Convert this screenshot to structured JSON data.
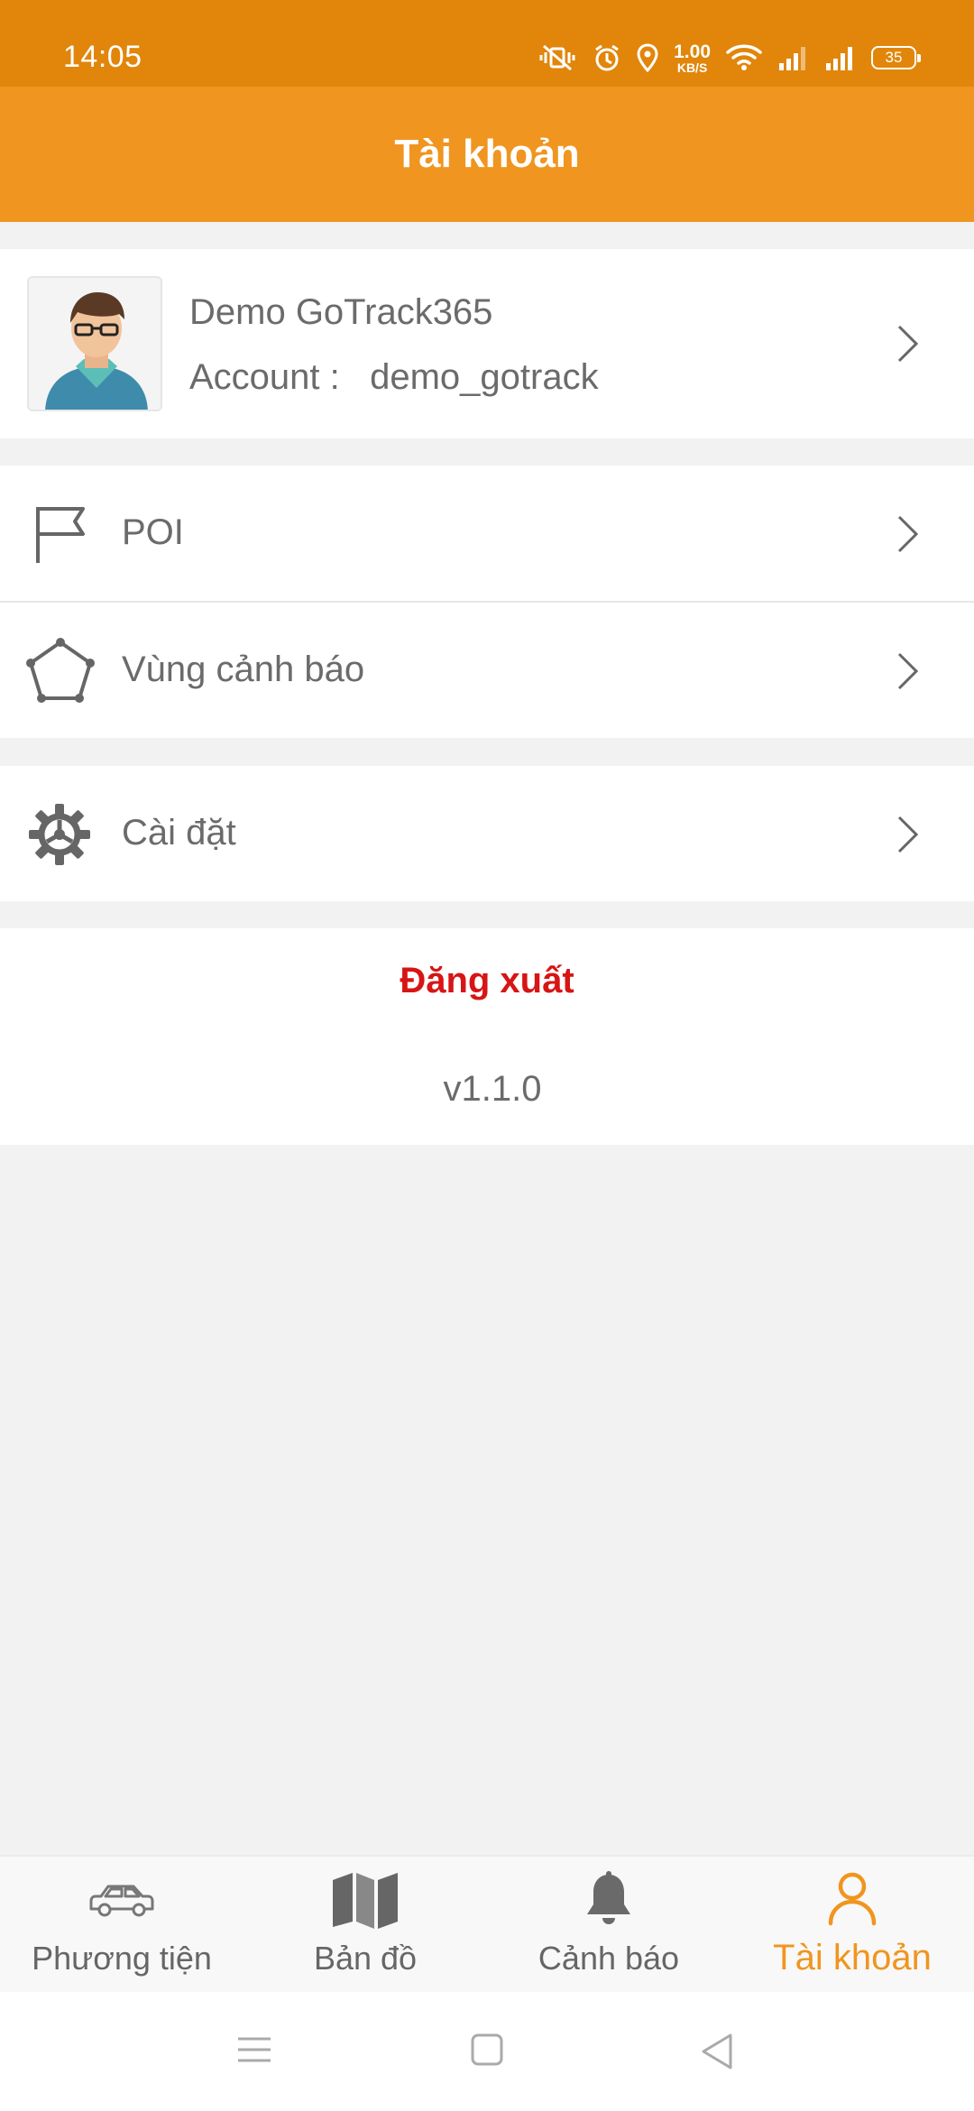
{
  "status_bar": {
    "time": "14:05",
    "net_speed_value": "1.00",
    "net_speed_unit": "KB/S",
    "battery": "35",
    "icons": [
      "vibrate-icon",
      "alarm-icon",
      "location-icon",
      "wifi-icon",
      "signal-icon",
      "signal-icon",
      "battery-icon"
    ]
  },
  "app_bar": {
    "title": "Tài khoản"
  },
  "profile": {
    "name": "Demo GoTrack365",
    "account_label": "Account :",
    "account_value": "demo_gotrack",
    "avatar_icon": "user-avatar"
  },
  "menu": {
    "poi_label": "POI",
    "zones_label": "Vùng cảnh báo",
    "settings_label": "Cài đặt"
  },
  "logout": {
    "label": "Đăng xuất"
  },
  "version": "v1.1.0",
  "bottom_nav": {
    "items": [
      {
        "label": "Phương tiện",
        "icon": "car-icon"
      },
      {
        "label": "Bản đồ",
        "icon": "map-icon"
      },
      {
        "label": "Cảnh báo",
        "icon": "bell-icon"
      },
      {
        "label": "Tài khoản",
        "icon": "user-icon"
      }
    ],
    "active_index": 3
  },
  "colors": {
    "status_bar": "#e1860a",
    "app_bar": "#f0951f",
    "accent": "#f0951f",
    "logout": "#d71515",
    "background": "#f2f2f2"
  }
}
